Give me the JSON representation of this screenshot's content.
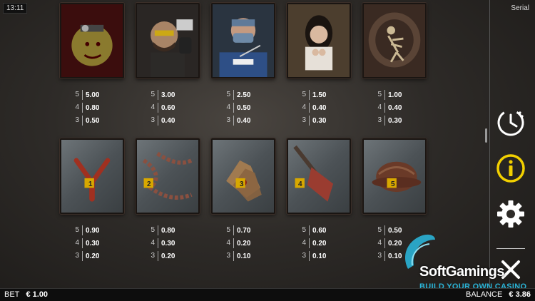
{
  "status": {
    "clock": "13:11",
    "game_name": "Serial"
  },
  "paytable": {
    "high_symbols": [
      {
        "icon": "zombie-surgeon",
        "pays": [
          {
            "count": "5",
            "value": "5.00"
          },
          {
            "count": "4",
            "value": "0.80"
          },
          {
            "count": "3",
            "value": "0.50"
          }
        ]
      },
      {
        "icon": "detective-with-badge",
        "pays": [
          {
            "count": "5",
            "value": "3.00"
          },
          {
            "count": "4",
            "value": "0.60"
          },
          {
            "count": "3",
            "value": "0.40"
          }
        ]
      },
      {
        "icon": "masked-surgeon",
        "pays": [
          {
            "count": "5",
            "value": "2.50"
          },
          {
            "count": "4",
            "value": "0.50"
          },
          {
            "count": "3",
            "value": "0.40"
          }
        ]
      },
      {
        "icon": "frightened-woman",
        "pays": [
          {
            "count": "5",
            "value": "1.50"
          },
          {
            "count": "4",
            "value": "0.40"
          },
          {
            "count": "3",
            "value": "0.30"
          }
        ]
      },
      {
        "icon": "skeleton-in-pit",
        "pays": [
          {
            "count": "5",
            "value": "1.00"
          },
          {
            "count": "4",
            "value": "0.40"
          },
          {
            "count": "3",
            "value": "0.30"
          }
        ]
      }
    ],
    "low_symbols": [
      {
        "icon": "evidence-slingshot",
        "marker": "1",
        "pays": [
          {
            "count": "5",
            "value": "0.90"
          },
          {
            "count": "4",
            "value": "0.30"
          },
          {
            "count": "3",
            "value": "0.20"
          }
        ]
      },
      {
        "icon": "evidence-chain",
        "marker": "2",
        "pays": [
          {
            "count": "5",
            "value": "0.80"
          },
          {
            "count": "4",
            "value": "0.30"
          },
          {
            "count": "3",
            "value": "0.20"
          }
        ]
      },
      {
        "icon": "evidence-gloves",
        "marker": "3",
        "pays": [
          {
            "count": "5",
            "value": "0.70"
          },
          {
            "count": "4",
            "value": "0.20"
          },
          {
            "count": "3",
            "value": "0.10"
          }
        ]
      },
      {
        "icon": "evidence-shovel",
        "marker": "4",
        "pays": [
          {
            "count": "5",
            "value": "0.60"
          },
          {
            "count": "4",
            "value": "0.20"
          },
          {
            "count": "3",
            "value": "0.10"
          }
        ]
      },
      {
        "icon": "evidence-helmet",
        "marker": "5",
        "pays": [
          {
            "count": "5",
            "value": "0.50"
          },
          {
            "count": "4",
            "value": "0.20"
          },
          {
            "count": "3",
            "value": "0.10"
          }
        ]
      }
    ]
  },
  "sidebar": {
    "icons": [
      "history-clock-icon",
      "info-icon",
      "settings-gear-icon",
      "close-icon"
    ]
  },
  "bottom_bar": {
    "bet_label": "BET",
    "bet_value": "€ 1.00",
    "balance_label": "BALANCE",
    "balance_value": "€ 3.86"
  },
  "watermark": {
    "name": "SoftGamings",
    "tagline": "BUILD YOUR OWN CASINO"
  },
  "colors": {
    "info_accent": "#f2d000",
    "watermark_accent": "#2ab3d6"
  }
}
